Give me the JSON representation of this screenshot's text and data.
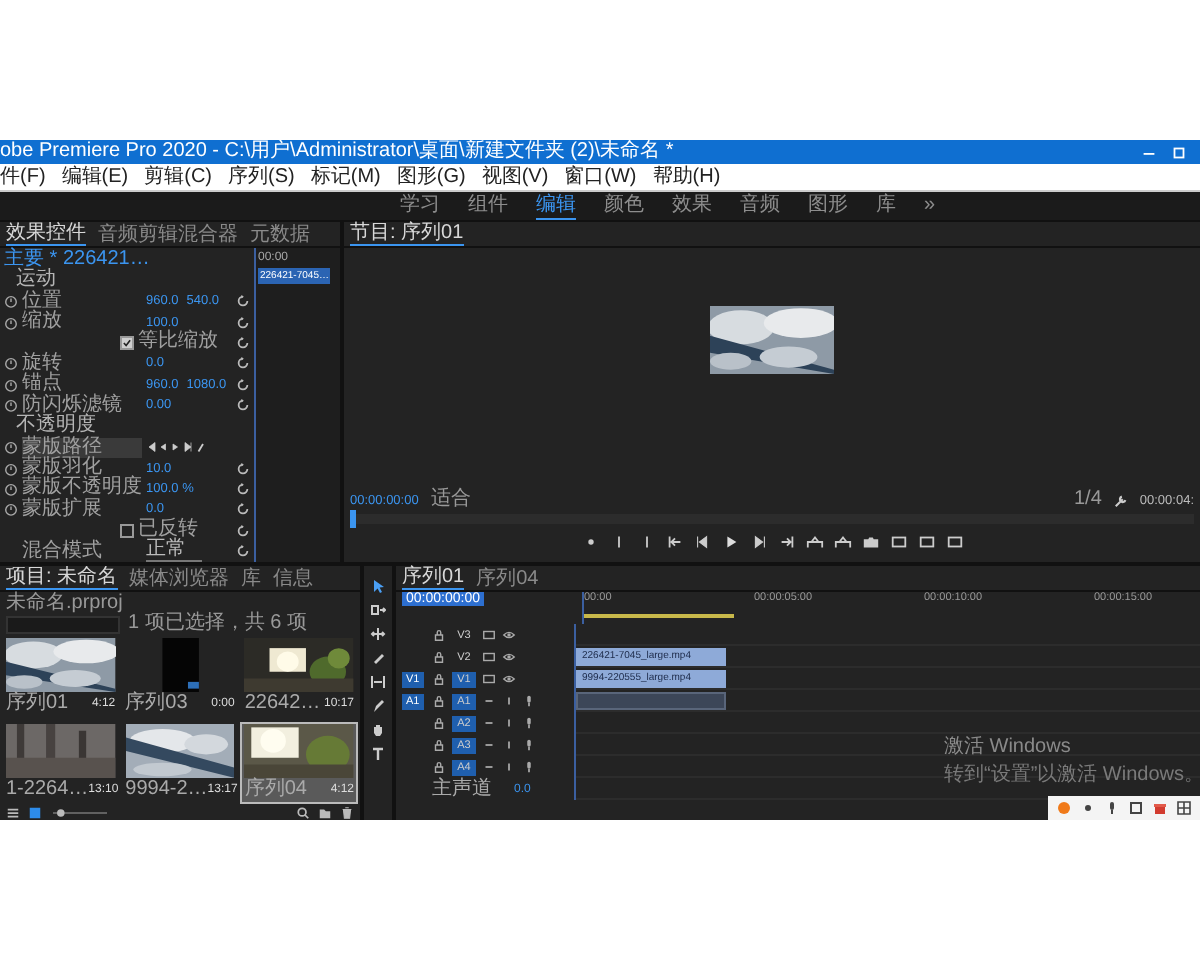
{
  "window": {
    "title": "obe Premiere Pro 2020 - C:\\用户\\Administrator\\桌面\\新建文件夹 (2)\\未命名 *"
  },
  "menu": [
    "件(F)",
    "编辑(E)",
    "剪辑(C)",
    "序列(S)",
    "标记(M)",
    "图形(G)",
    "视图(V)",
    "窗口(W)",
    "帮助(H)"
  ],
  "workspaces": [
    {
      "label": "学习",
      "selected": false
    },
    {
      "label": "组件",
      "selected": false
    },
    {
      "label": "编辑",
      "selected": true
    },
    {
      "label": "颜色",
      "selected": false
    },
    {
      "label": "效果",
      "selected": false
    },
    {
      "label": "音频",
      "selected": false
    },
    {
      "label": "图形",
      "selected": false
    },
    {
      "label": "库",
      "selected": false
    },
    {
      "label": "»",
      "selected": false
    }
  ],
  "effect_controls": {
    "tabs": [
      {
        "label": "效果控件",
        "selected": true
      },
      {
        "label": "音频剪辑混合器",
        "selected": false
      },
      {
        "label": "元数据",
        "selected": false
      }
    ],
    "source": "主要 * 226421…",
    "rows": [
      {
        "kind": "section",
        "label": "运动"
      },
      {
        "kind": "param",
        "label": "位置",
        "values": [
          "960.0",
          "540.0"
        ]
      },
      {
        "kind": "param",
        "label": "缩放",
        "values": [
          "100.0"
        ]
      },
      {
        "kind": "checkbox",
        "label": "等比缩放",
        "checked": true
      },
      {
        "kind": "param",
        "label": "旋转",
        "values": [
          "0.0"
        ]
      },
      {
        "kind": "param",
        "label": "锚点",
        "values": [
          "960.0",
          "1080.0"
        ]
      },
      {
        "kind": "param",
        "label": "防闪烁滤镜",
        "values": [
          "0.00"
        ]
      },
      {
        "kind": "section",
        "label": "不透明度"
      },
      {
        "kind": "mask",
        "label": "蒙版路径"
      },
      {
        "kind": "param",
        "label": "蒙版羽化",
        "values": [
          "10.0"
        ]
      },
      {
        "kind": "param",
        "label": "蒙版不透明度",
        "values": [
          "100.0 %"
        ]
      },
      {
        "kind": "param",
        "label": "蒙版扩展",
        "values": [
          "0.0"
        ]
      },
      {
        "kind": "checkbox",
        "label": "已反转",
        "checked": false
      },
      {
        "kind": "select",
        "label": "混合模式",
        "value": "正常"
      }
    ]
  },
  "mini_timeline": {
    "time": "00:00",
    "clip": "226421-7045…"
  },
  "program": {
    "title": "节目: 序列01",
    "timecode": "00:00:00:00",
    "zoom": "适合",
    "resolution": "1/4",
    "duration": "00:00:04:"
  },
  "project": {
    "tabs": [
      {
        "label": "项目: 未命名",
        "selected": true
      },
      {
        "label": "媒体浏览器",
        "selected": false
      },
      {
        "label": "库",
        "selected": false
      },
      {
        "label": "信息",
        "selected": false
      }
    ],
    "file": "未命名.prproj",
    "zoom_slider": {
      "level": 0.1
    },
    "selection": "1 项已选择，共 6 项",
    "items": [
      {
        "name": "序列01",
        "duration": "4:12",
        "selected": false
      },
      {
        "name": "序列03",
        "duration": "0:00",
        "selected": false
      },
      {
        "name": "22642…",
        "duration": "10:17",
        "selected": false
      },
      {
        "name": "1-2264…",
        "duration": "13:10",
        "selected": false
      },
      {
        "name": "9994-2…",
        "duration": "13:17",
        "selected": false
      },
      {
        "name": "序列04",
        "duration": "4:12",
        "selected": true
      }
    ]
  },
  "timeline": {
    "tabs": [
      {
        "label": "序列01",
        "selected": true
      },
      {
        "label": "序列04",
        "selected": false
      }
    ],
    "timecode": "00:00:00:00",
    "ruler": [
      "00:00",
      "00:00:05:00",
      "00:00:10:00",
      "00:00:15:00"
    ],
    "tracks": [
      {
        "name": "V3",
        "kind": "video",
        "targeted": false
      },
      {
        "name": "V2",
        "kind": "video",
        "targeted": false,
        "clip": {
          "kind": "video",
          "label": "226421-7045_large.mp4"
        }
      },
      {
        "name": "V1",
        "kind": "video",
        "targeted": true,
        "source": "V1",
        "clip": {
          "kind": "video",
          "label": "9994-220555_large.mp4"
        }
      },
      {
        "name": "A1",
        "kind": "audio",
        "targeted": true,
        "source": "A1",
        "clip": {
          "kind": "audio"
        }
      },
      {
        "name": "A2",
        "kind": "audio",
        "targeted": true
      },
      {
        "name": "A3",
        "kind": "audio",
        "targeted": true
      },
      {
        "name": "A4",
        "kind": "audio",
        "targeted": true
      }
    ],
    "master": {
      "label": "主声道",
      "value": "0.0"
    }
  },
  "system": {
    "activation_title": "激活 Windows",
    "activation_hint": "转到“设置”以激活 Windows。"
  }
}
